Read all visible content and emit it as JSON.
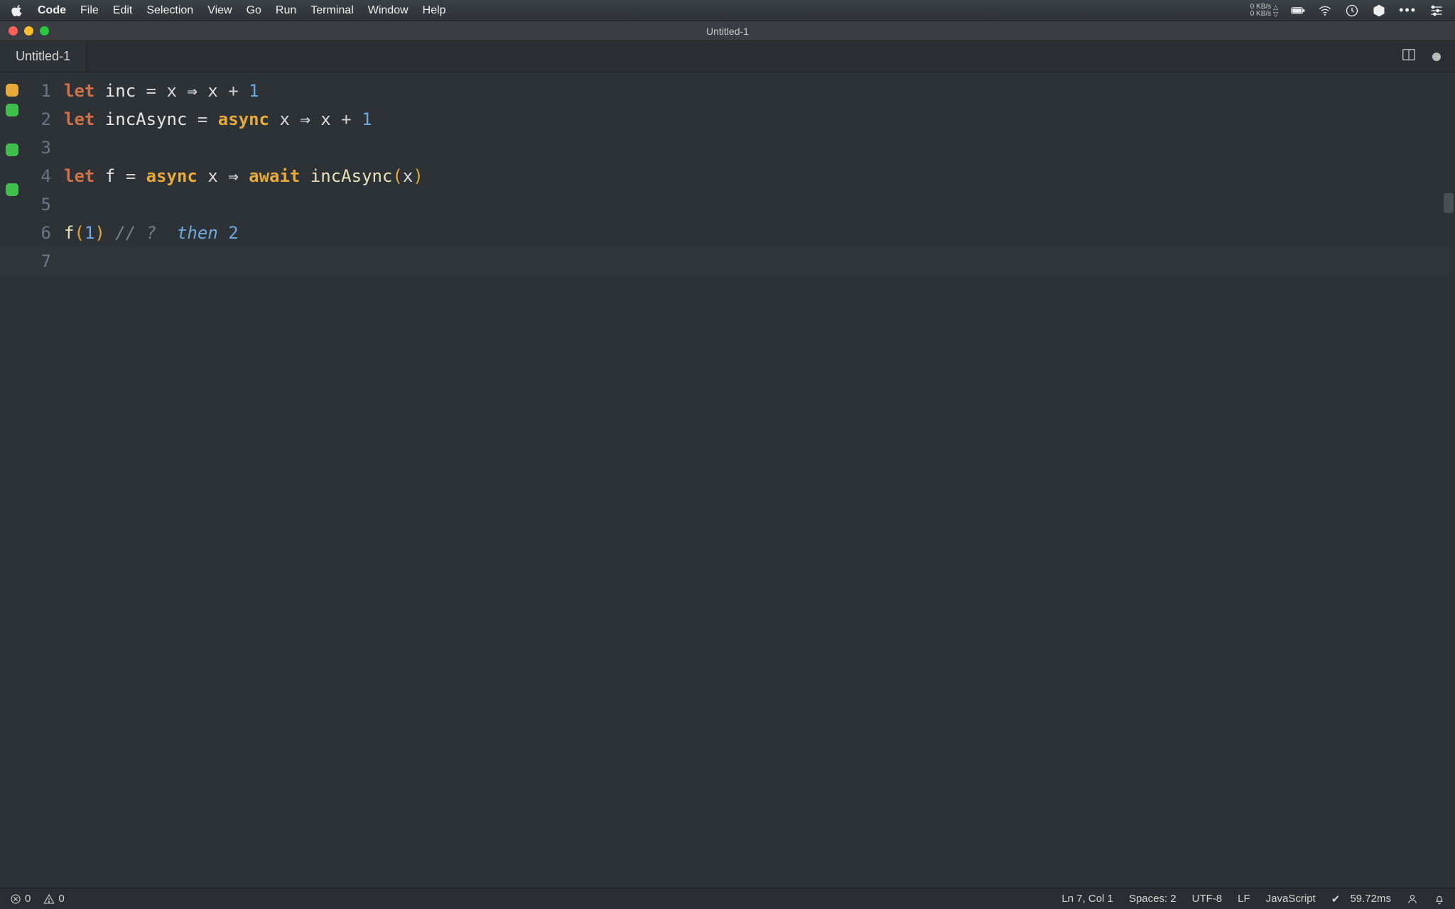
{
  "mac_menu": {
    "app": "Code",
    "items": [
      "File",
      "Edit",
      "Selection",
      "View",
      "Go",
      "Run",
      "Terminal",
      "Window",
      "Help"
    ],
    "net_up": "0 KB/s",
    "net_down": "0 KB/s"
  },
  "window": {
    "title": "Untitled-1"
  },
  "tab": {
    "label": "Untitled-1"
  },
  "code": {
    "lines": [
      {
        "n": "1",
        "dec": "yellow",
        "segments": [
          [
            "kw",
            "let "
          ],
          [
            "fn",
            "inc"
          ],
          [
            "op",
            " = "
          ],
          [
            "var",
            "x"
          ],
          [
            "op",
            " "
          ],
          [
            "arrow",
            "⇒"
          ],
          [
            "op",
            " "
          ],
          [
            "var",
            "x"
          ],
          [
            "op",
            " + "
          ],
          [
            "num",
            "1"
          ]
        ]
      },
      {
        "n": "2",
        "dec": "green",
        "segments": [
          [
            "kw",
            "let "
          ],
          [
            "fn",
            "incAsync"
          ],
          [
            "op",
            " = "
          ],
          [
            "async",
            "async"
          ],
          [
            "op",
            " "
          ],
          [
            "var",
            "x"
          ],
          [
            "op",
            " "
          ],
          [
            "arrow",
            "⇒"
          ],
          [
            "op",
            " "
          ],
          [
            "var",
            "x"
          ],
          [
            "op",
            " + "
          ],
          [
            "num",
            "1"
          ]
        ]
      },
      {
        "n": "3",
        "dec": "",
        "segments": []
      },
      {
        "n": "4",
        "dec": "green",
        "segments": [
          [
            "kw",
            "let "
          ],
          [
            "fn",
            "f"
          ],
          [
            "op",
            " = "
          ],
          [
            "async",
            "async"
          ],
          [
            "op",
            " "
          ],
          [
            "var",
            "x"
          ],
          [
            "op",
            " "
          ],
          [
            "arrow",
            "⇒"
          ],
          [
            "op",
            " "
          ],
          [
            "await",
            "await"
          ],
          [
            "op",
            " "
          ],
          [
            "call",
            "incAsync"
          ],
          [
            "paren",
            "("
          ],
          [
            "var",
            "x"
          ],
          [
            "paren",
            ")"
          ]
        ]
      },
      {
        "n": "5",
        "dec": "",
        "segments": []
      },
      {
        "n": "6",
        "dec": "green",
        "segments": [
          [
            "call",
            "f"
          ],
          [
            "paren",
            "("
          ],
          [
            "num",
            "1"
          ],
          [
            "paren",
            ")"
          ],
          [
            "op",
            " "
          ],
          [
            "comment",
            "// ?  "
          ],
          [
            "then",
            "then "
          ],
          [
            "num",
            "2"
          ]
        ]
      },
      {
        "n": "7",
        "dec": "",
        "segments": [],
        "active": true
      }
    ]
  },
  "status": {
    "errors": "0",
    "warnings": "0",
    "ln_col": "Ln 7, Col 1",
    "spaces": "Spaces: 2",
    "encoding": "UTF-8",
    "eol": "LF",
    "language": "JavaScript",
    "timing_check": "✔",
    "timing": "59.72ms"
  }
}
